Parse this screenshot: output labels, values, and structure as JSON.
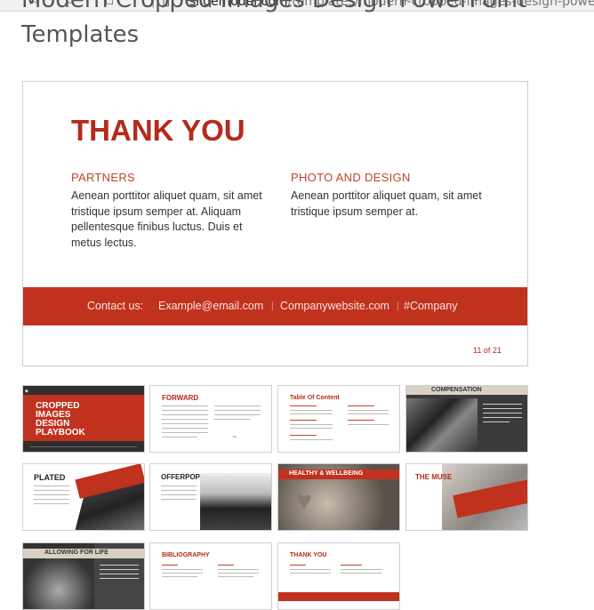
{
  "browser": {
    "url_domain": "slidemodel.com",
    "url_path": "/templates/modern-cropped-images-design-powerpoint-temp"
  },
  "page": {
    "title_line1": "Modern Cropped Images Design PowerPoint",
    "title_line2": "Templates"
  },
  "slide": {
    "heading": "THANK YOU",
    "col1_heading": "PARTNERS",
    "col1_text": "Aenean porttitor aliquet quam, sit amet tristique ipsum semper at. Aliquam pellentesque finibus luctus. Duis et metus lectus.",
    "col2_heading": "PHOTO AND DESIGN",
    "col2_text": "Aenean porttitor aliquet quam, sit amet tristique ipsum semper at.",
    "contact_label": "Contact us:",
    "email": "Example@email.com",
    "website": "Companywebsite.com",
    "hashtag": "#Company",
    "page_indicator": "11 of 21",
    "accent_color": "#c0321e"
  },
  "thumbnails": {
    "t1_title": "CROPPED IMAGES DESIGN PLAYBOOK",
    "t2_title": "FORWARD",
    "t3_title": "Table Of Content",
    "t4_title": "COMPENSATION",
    "t5_title": "PLATED",
    "t6_title": "OFFERPOP",
    "t7_title": "HEALTHY & WELLBEING",
    "t8_title": "THE MUSE",
    "t9_title": "ALLOWING FOR LIFE",
    "t10_title": "BIBLIOGRAPHY",
    "t11_title": "THANK YOU"
  }
}
